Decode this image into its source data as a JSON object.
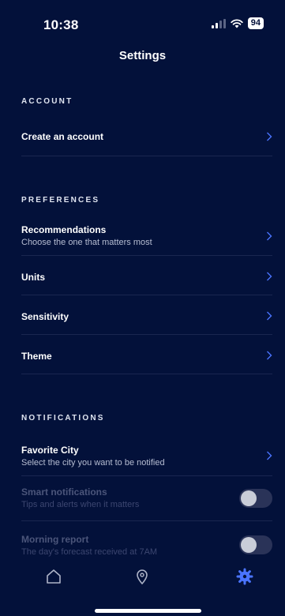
{
  "status_bar": {
    "time": "10:38",
    "battery": "94"
  },
  "header": {
    "title": "Settings"
  },
  "sections": {
    "account": {
      "title": "ACCOUNT",
      "items": [
        {
          "label": "Create an account"
        }
      ]
    },
    "preferences": {
      "title": "PREFERENCES",
      "items": [
        {
          "label": "Recommendations",
          "subtitle": "Choose the one that matters most"
        },
        {
          "label": "Units"
        },
        {
          "label": "Sensitivity"
        },
        {
          "label": "Theme"
        }
      ]
    },
    "notifications": {
      "title": "NOTIFICATIONS",
      "items": [
        {
          "label": "Favorite City",
          "subtitle": "Select the city you want to be notified"
        },
        {
          "label": "Smart notifications",
          "subtitle": "Tips and alerts when it matters",
          "toggle_on": false,
          "disabled": true
        },
        {
          "label": "Morning report",
          "subtitle": "The day's forecast received at 7AM",
          "toggle_on": false,
          "disabled": true
        }
      ]
    }
  },
  "tab_bar": {
    "tabs": [
      {
        "icon": "home-icon",
        "active": false
      },
      {
        "icon": "location-pin-icon",
        "active": false
      },
      {
        "icon": "settings-gear-icon",
        "active": true
      }
    ]
  },
  "colors": {
    "background": "#03113a",
    "accent": "#4a74ff",
    "divider": "#1a2650",
    "muted_text": "#b6bdd2"
  }
}
